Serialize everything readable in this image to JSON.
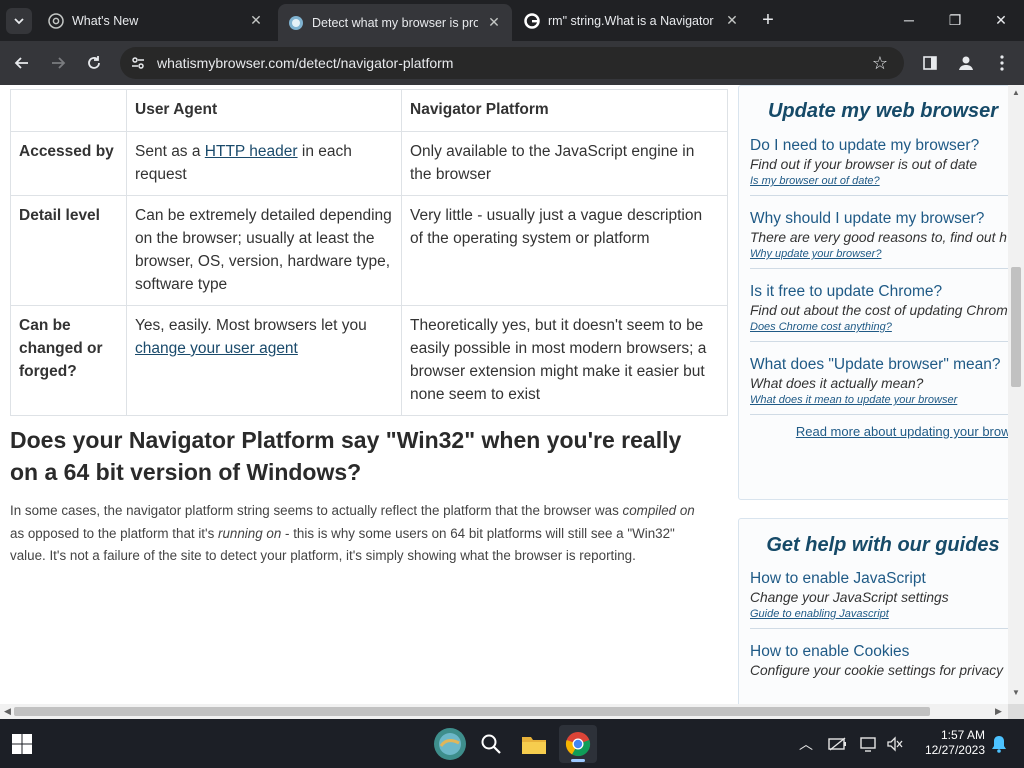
{
  "browser": {
    "tabs": [
      {
        "title": "What's New",
        "active": false
      },
      {
        "title": "Detect what my browser is prov",
        "active": true
      },
      {
        "title": "rm\" string.What is a Navigator f",
        "active": false
      }
    ],
    "url": "whatismybrowser.com/detect/navigator-platform"
  },
  "table": {
    "headers": [
      "",
      "User Agent",
      "Navigator Platform"
    ],
    "rows": [
      {
        "label": "Accessed by",
        "ua_pre": "Sent as a ",
        "ua_link": "HTTP header",
        "ua_post": " in each request",
        "np": "Only available to the JavaScript engine in the browser"
      },
      {
        "label": "Detail level",
        "ua": "Can be extremely detailed depending on the browser; usually at least the browser, OS, version, hardware type, software type",
        "np": "Very little - usually just a vague description of the operating system or platform"
      },
      {
        "label": "Can be changed or forged?",
        "ua_pre": "Yes, easily. Most browsers let you ",
        "ua_link": "change your user agent",
        "np": "Theoretically yes, but it doesn't seem to be easily possible in most modern browsers; a browser extension might make it easier but none seem to exist"
      }
    ]
  },
  "article": {
    "heading": "Does your Navigator Platform say \"Win32\" when you're really on a 64 bit version of Windows?",
    "p_pre": "In some cases, the navigator platform string seems to actually reflect the platform that the browser was ",
    "p_em1": "compiled on",
    "p_mid": " as opposed to the platform that it's ",
    "p_em2": "running on",
    "p_post": " - this is why some users on 64 bit platforms will still see a \"Win32\" value. It's not a failure of the site to detect your platform, it's simply showing what the browser is reporting."
  },
  "sidebar": {
    "update": {
      "title": "Update my web browser",
      "items": [
        {
          "q": "Do I need to update my browser?",
          "sub": "Find out if your browser is out of date",
          "link": "Is my browser out of date?"
        },
        {
          "q": "Why should I update my browser?",
          "sub": "There are very good reasons to, find out h",
          "link": "Why update your browser?"
        },
        {
          "q": "Is it free to update Chrome?",
          "sub": "Find out about the cost of updating Chrom",
          "link": "Does Chrome cost anything?"
        },
        {
          "q": "What does \"Update browser\" mean?",
          "sub": "What does it actually mean?",
          "link": "What does it mean to update your browser"
        }
      ],
      "more": "Read more about updating your brows"
    },
    "guides": {
      "title": "Get help with our guides",
      "items": [
        {
          "q": "How to enable JavaScript",
          "sub": "Change your JavaScript settings",
          "link": "Guide to enabling Javascript"
        },
        {
          "q": "How to enable Cookies",
          "sub": "Configure your cookie settings for privacy",
          "link": ""
        }
      ]
    }
  },
  "taskbar": {
    "time": "1:57 AM",
    "date": "12/27/2023"
  }
}
